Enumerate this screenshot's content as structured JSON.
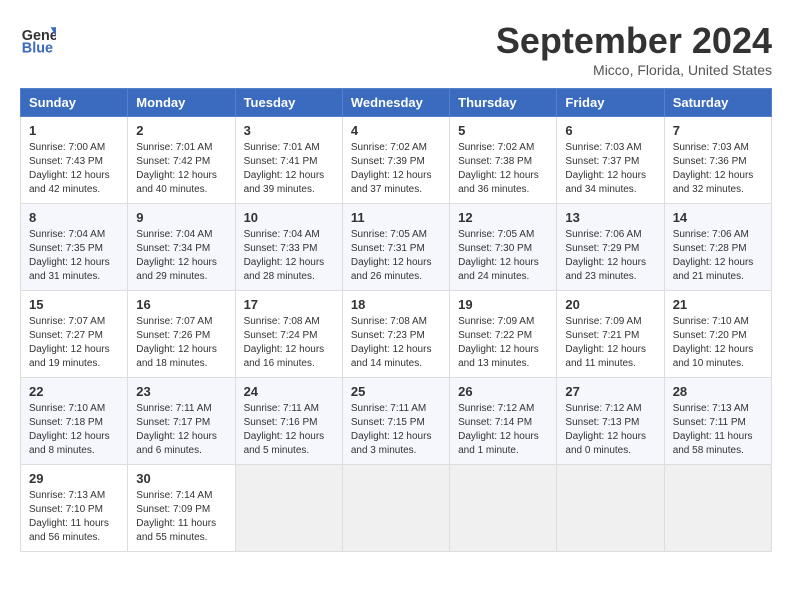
{
  "logo": {
    "line1": "General",
    "line2": "Blue"
  },
  "title": "September 2024",
  "location": "Micco, Florida, United States",
  "days_of_week": [
    "Sunday",
    "Monday",
    "Tuesday",
    "Wednesday",
    "Thursday",
    "Friday",
    "Saturday"
  ],
  "weeks": [
    [
      {
        "day": "1",
        "text": "Sunrise: 7:00 AM\nSunset: 7:43 PM\nDaylight: 12 hours\nand 42 minutes."
      },
      {
        "day": "2",
        "text": "Sunrise: 7:01 AM\nSunset: 7:42 PM\nDaylight: 12 hours\nand 40 minutes."
      },
      {
        "day": "3",
        "text": "Sunrise: 7:01 AM\nSunset: 7:41 PM\nDaylight: 12 hours\nand 39 minutes."
      },
      {
        "day": "4",
        "text": "Sunrise: 7:02 AM\nSunset: 7:39 PM\nDaylight: 12 hours\nand 37 minutes."
      },
      {
        "day": "5",
        "text": "Sunrise: 7:02 AM\nSunset: 7:38 PM\nDaylight: 12 hours\nand 36 minutes."
      },
      {
        "day": "6",
        "text": "Sunrise: 7:03 AM\nSunset: 7:37 PM\nDaylight: 12 hours\nand 34 minutes."
      },
      {
        "day": "7",
        "text": "Sunrise: 7:03 AM\nSunset: 7:36 PM\nDaylight: 12 hours\nand 32 minutes."
      }
    ],
    [
      {
        "day": "8",
        "text": "Sunrise: 7:04 AM\nSunset: 7:35 PM\nDaylight: 12 hours\nand 31 minutes."
      },
      {
        "day": "9",
        "text": "Sunrise: 7:04 AM\nSunset: 7:34 PM\nDaylight: 12 hours\nand 29 minutes."
      },
      {
        "day": "10",
        "text": "Sunrise: 7:04 AM\nSunset: 7:33 PM\nDaylight: 12 hours\nand 28 minutes."
      },
      {
        "day": "11",
        "text": "Sunrise: 7:05 AM\nSunset: 7:31 PM\nDaylight: 12 hours\nand 26 minutes."
      },
      {
        "day": "12",
        "text": "Sunrise: 7:05 AM\nSunset: 7:30 PM\nDaylight: 12 hours\nand 24 minutes."
      },
      {
        "day": "13",
        "text": "Sunrise: 7:06 AM\nSunset: 7:29 PM\nDaylight: 12 hours\nand 23 minutes."
      },
      {
        "day": "14",
        "text": "Sunrise: 7:06 AM\nSunset: 7:28 PM\nDaylight: 12 hours\nand 21 minutes."
      }
    ],
    [
      {
        "day": "15",
        "text": "Sunrise: 7:07 AM\nSunset: 7:27 PM\nDaylight: 12 hours\nand 19 minutes."
      },
      {
        "day": "16",
        "text": "Sunrise: 7:07 AM\nSunset: 7:26 PM\nDaylight: 12 hours\nand 18 minutes."
      },
      {
        "day": "17",
        "text": "Sunrise: 7:08 AM\nSunset: 7:24 PM\nDaylight: 12 hours\nand 16 minutes."
      },
      {
        "day": "18",
        "text": "Sunrise: 7:08 AM\nSunset: 7:23 PM\nDaylight: 12 hours\nand 14 minutes."
      },
      {
        "day": "19",
        "text": "Sunrise: 7:09 AM\nSunset: 7:22 PM\nDaylight: 12 hours\nand 13 minutes."
      },
      {
        "day": "20",
        "text": "Sunrise: 7:09 AM\nSunset: 7:21 PM\nDaylight: 12 hours\nand 11 minutes."
      },
      {
        "day": "21",
        "text": "Sunrise: 7:10 AM\nSunset: 7:20 PM\nDaylight: 12 hours\nand 10 minutes."
      }
    ],
    [
      {
        "day": "22",
        "text": "Sunrise: 7:10 AM\nSunset: 7:18 PM\nDaylight: 12 hours\nand 8 minutes."
      },
      {
        "day": "23",
        "text": "Sunrise: 7:11 AM\nSunset: 7:17 PM\nDaylight: 12 hours\nand 6 minutes."
      },
      {
        "day": "24",
        "text": "Sunrise: 7:11 AM\nSunset: 7:16 PM\nDaylight: 12 hours\nand 5 minutes."
      },
      {
        "day": "25",
        "text": "Sunrise: 7:11 AM\nSunset: 7:15 PM\nDaylight: 12 hours\nand 3 minutes."
      },
      {
        "day": "26",
        "text": "Sunrise: 7:12 AM\nSunset: 7:14 PM\nDaylight: 12 hours\nand 1 minute."
      },
      {
        "day": "27",
        "text": "Sunrise: 7:12 AM\nSunset: 7:13 PM\nDaylight: 12 hours\nand 0 minutes."
      },
      {
        "day": "28",
        "text": "Sunrise: 7:13 AM\nSunset: 7:11 PM\nDaylight: 11 hours\nand 58 minutes."
      }
    ],
    [
      {
        "day": "29",
        "text": "Sunrise: 7:13 AM\nSunset: 7:10 PM\nDaylight: 11 hours\nand 56 minutes."
      },
      {
        "day": "30",
        "text": "Sunrise: 7:14 AM\nSunset: 7:09 PM\nDaylight: 11 hours\nand 55 minutes."
      },
      {
        "day": "",
        "text": ""
      },
      {
        "day": "",
        "text": ""
      },
      {
        "day": "",
        "text": ""
      },
      {
        "day": "",
        "text": ""
      },
      {
        "day": "",
        "text": ""
      }
    ]
  ]
}
